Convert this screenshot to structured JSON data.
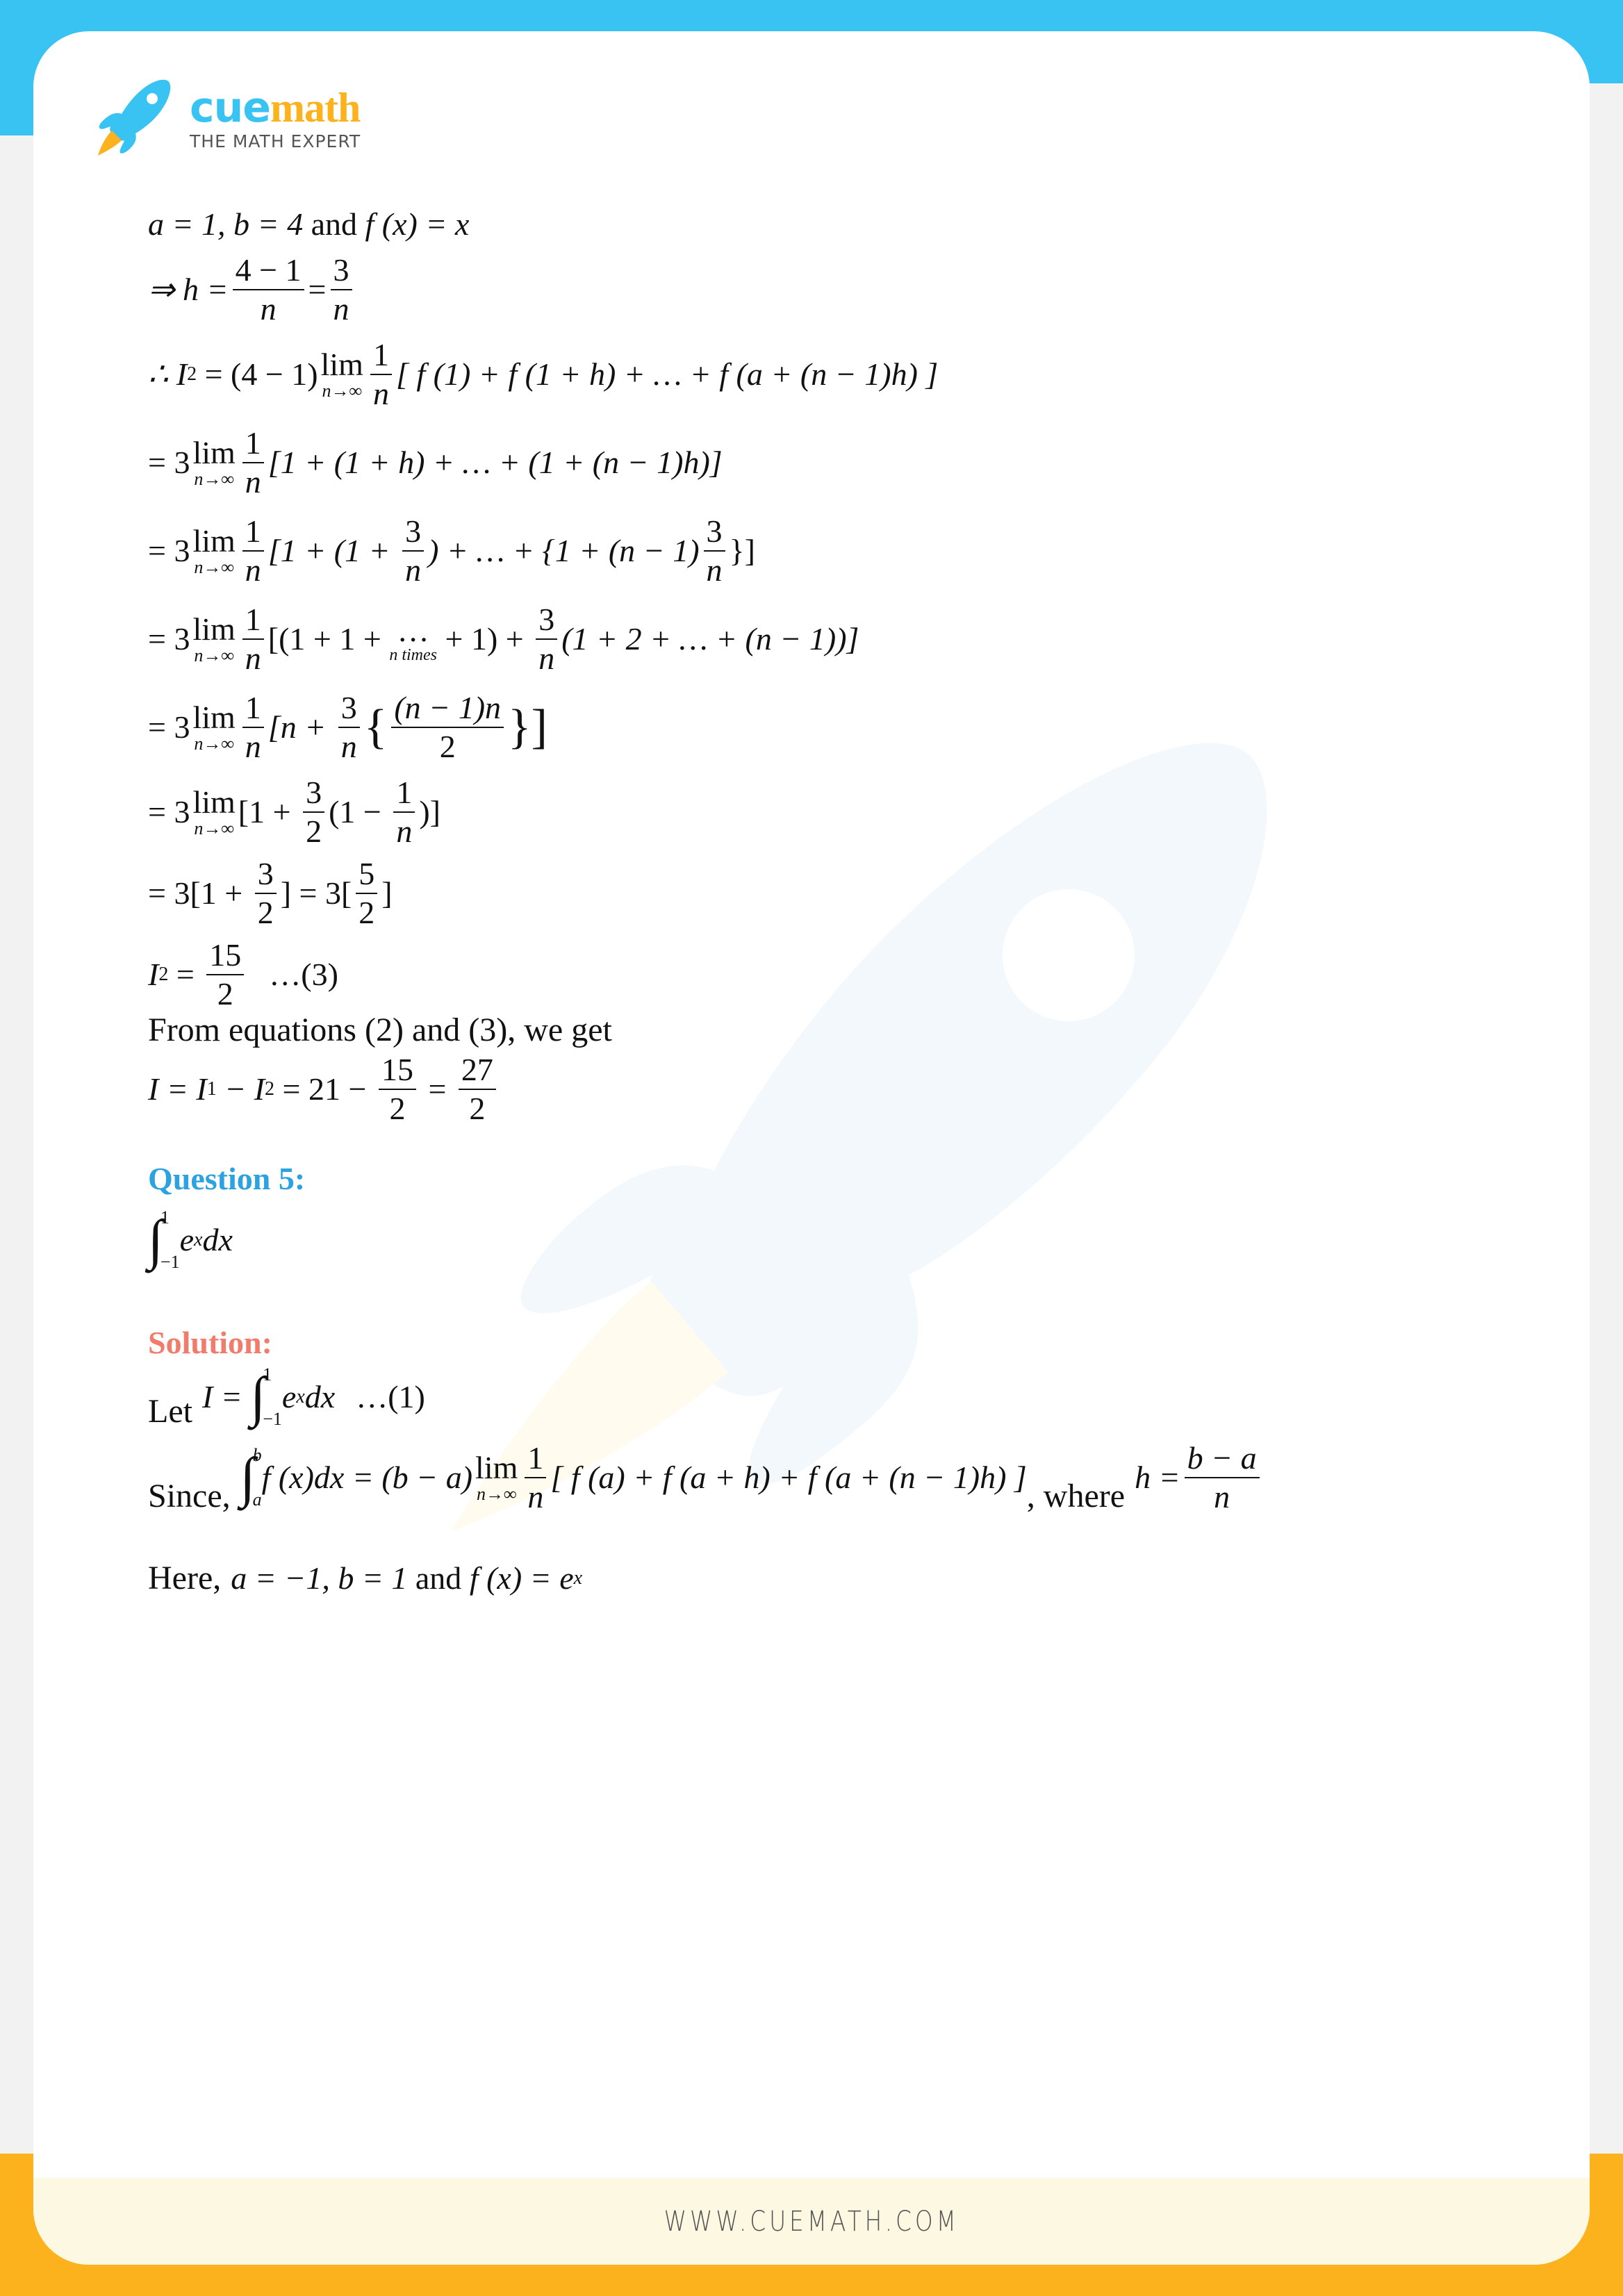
{
  "brand": {
    "name_part1": "cue",
    "name_part2": "math",
    "tagline": "THE MATH EXPERT",
    "colors": {
      "blue": "#38c3f3",
      "orange": "#fcb21c",
      "question": "#2ca3e0",
      "solution": "#f27c6c"
    }
  },
  "icons": {
    "logo": "rocket-icon",
    "watermark": "rocket-watermark-icon"
  },
  "content": {
    "line1": {
      "a_eq": "a = 1, b = 4",
      "and": " and ",
      "f": "f (x) = x"
    },
    "line2": {
      "prefix": "⇒ h =",
      "num1": "4 − 1",
      "den1": "n",
      "eq": "=",
      "num2": "3",
      "den2": "n"
    },
    "line3": {
      "prefix": "∴ I",
      "sub": "2",
      "mid": " = (4 − 1)",
      "lim": "lim",
      "lim_sub": "n→∞",
      "fnum": "1",
      "fden": "n",
      "body": "[ f (1) + f (1 + h) + … + f (a + (n − 1)h) ]"
    },
    "line4": {
      "prefix": "= 3",
      "lim": "lim",
      "lim_sub": "n→∞",
      "fnum": "1",
      "fden": "n",
      "body": "[1 + (1 + h) + … + (1 + (n − 1)h)]"
    },
    "line5": {
      "prefix": "= 3",
      "lim": "lim",
      "lim_sub": "n→∞",
      "fnum": "1",
      "fden": "n",
      "b1": "[1 + (1 + ",
      "f2num": "3",
      "f2den": "n",
      "b2": ") + … + {1 + (n − 1)",
      "f3num": "3",
      "f3den": "n",
      "b3": "}]"
    },
    "line6": {
      "prefix": "= 3",
      "lim": "lim",
      "lim_sub": "n→∞",
      "fnum": "1",
      "fden": "n",
      "b1": "[(1 + 1 + ",
      "dots": "…",
      "dots_label": "n times",
      "b2": " + 1) + ",
      "f2num": "3",
      "f2den": "n",
      "b3": "(1 + 2 + … + (n − 1))]"
    },
    "line7": {
      "prefix": "= 3",
      "lim": "lim",
      "lim_sub": "n→∞",
      "fnum": "1",
      "fden": "n",
      "b1": "[n + ",
      "f2num": "3",
      "f2den": "n",
      "b2": "{",
      "f3num": "(n − 1)n",
      "f3den": "2",
      "b3": "}]"
    },
    "line8": {
      "prefix": "= 3",
      "lim": "lim",
      "lim_sub": "n→∞",
      "b1": "[1 + ",
      "f1num": "3",
      "f1den": "2",
      "b2": "(1 − ",
      "f2num": "1",
      "f2den": "n",
      "b3": ")]"
    },
    "line9": {
      "b1": "= 3[1 + ",
      "f1num": "3",
      "f1den": "2",
      "b2": "] = 3[",
      "f2num": "5",
      "f2den": "2",
      "b3": "]"
    },
    "line10": {
      "prefix": "I",
      "sub": "2",
      "eq": " = ",
      "fnum": "15",
      "fden": "2",
      "tag": "…(3)"
    },
    "line11": "From equations (2) and (3), we get",
    "line12": {
      "p1": "I = I",
      "s1": "1",
      "p2": " − I",
      "s2": "2",
      "p3": " = 21 − ",
      "f1num": "15",
      "f1den": "2",
      "eq": " = ",
      "f2num": "27",
      "f2den": "2"
    },
    "question_title": "Question 5:",
    "question_expr": {
      "int": "∫",
      "upper": "1",
      "lower": "−1",
      "body": "e",
      "sup": "x",
      "dx": "dx"
    },
    "solution_title": "Solution:",
    "let_line": {
      "let": "Let",
      "I_eq": "I = ",
      "int": "∫",
      "upper": "1",
      "lower": "−1",
      "body": "e",
      "sup": "x",
      "dx": "dx",
      "tag": "…(1)"
    },
    "since_line": {
      "since": "Since,",
      "int": "∫",
      "upper": "b",
      "lower": "a",
      "lhs": "f (x)dx = (b − a)",
      "lim": "lim",
      "lim_sub": "n→∞",
      "fnum": "1",
      "fden": "n",
      "body": "[ f (a) + f (a + h) + f (a + (n − 1)h) ]",
      "where": ", where",
      "h_eq": "h =",
      "hnum": "b − a",
      "hden": "n"
    },
    "here_line": {
      "here": "Here,",
      "vals": "a = −1, b = 1",
      "and": " and ",
      "f": "f (x) = e",
      "sup": "x"
    }
  },
  "footer": {
    "url": "WWW.CUEMATH.COM"
  }
}
